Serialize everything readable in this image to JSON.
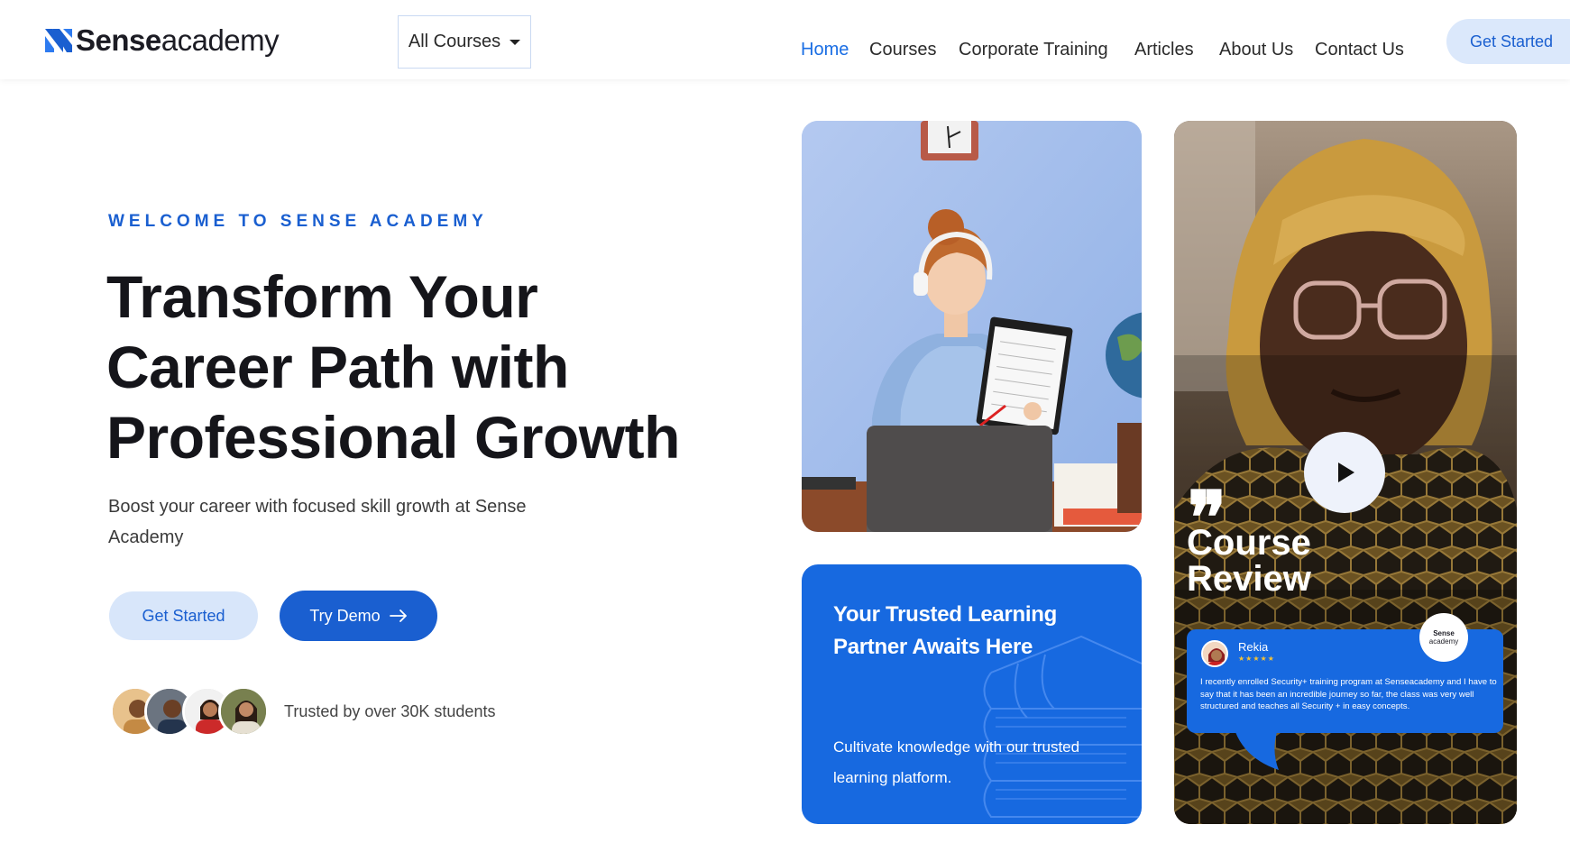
{
  "brand": {
    "name_bold": "Sense",
    "name_rest": "academy",
    "accent": "#1a5fd0"
  },
  "header": {
    "courses_dropdown": "All Courses",
    "nav": [
      {
        "label": "Home",
        "active": true
      },
      {
        "label": "Courses",
        "active": false
      },
      {
        "label": "Corporate Training",
        "active": false
      },
      {
        "label": "Articles",
        "active": false
      },
      {
        "label": "About Us",
        "active": false
      },
      {
        "label": "Contact Us",
        "active": false
      }
    ],
    "cta": "Get Started"
  },
  "hero": {
    "eyebrow": "WELCOME TO SENSE ACADEMY",
    "title": "Transform Your Career Path with Professional Growth",
    "subtitle": "Boost your career with focused skill growth at Sense Academy",
    "primary_button": "Get Started",
    "demo_button": "Try Demo",
    "trust_text": "Trusted by over 30K students"
  },
  "cards": {
    "trusted": {
      "title": "Your Trusted Learning Partner Awaits Here",
      "subtitle": "Cultivate knowledge with our trusted learning platform."
    },
    "review": {
      "title": "Course Review",
      "reviewer": "Rekia",
      "stars": "★★★★★",
      "text": "I recently enrolled Security+ training program at Senseacademy and I have to say that it has been an incredible journey so far, the class was very well structured and teaches all Security + in easy concepts.",
      "badge_bold": "Sense",
      "badge_rest": "academy"
    }
  }
}
